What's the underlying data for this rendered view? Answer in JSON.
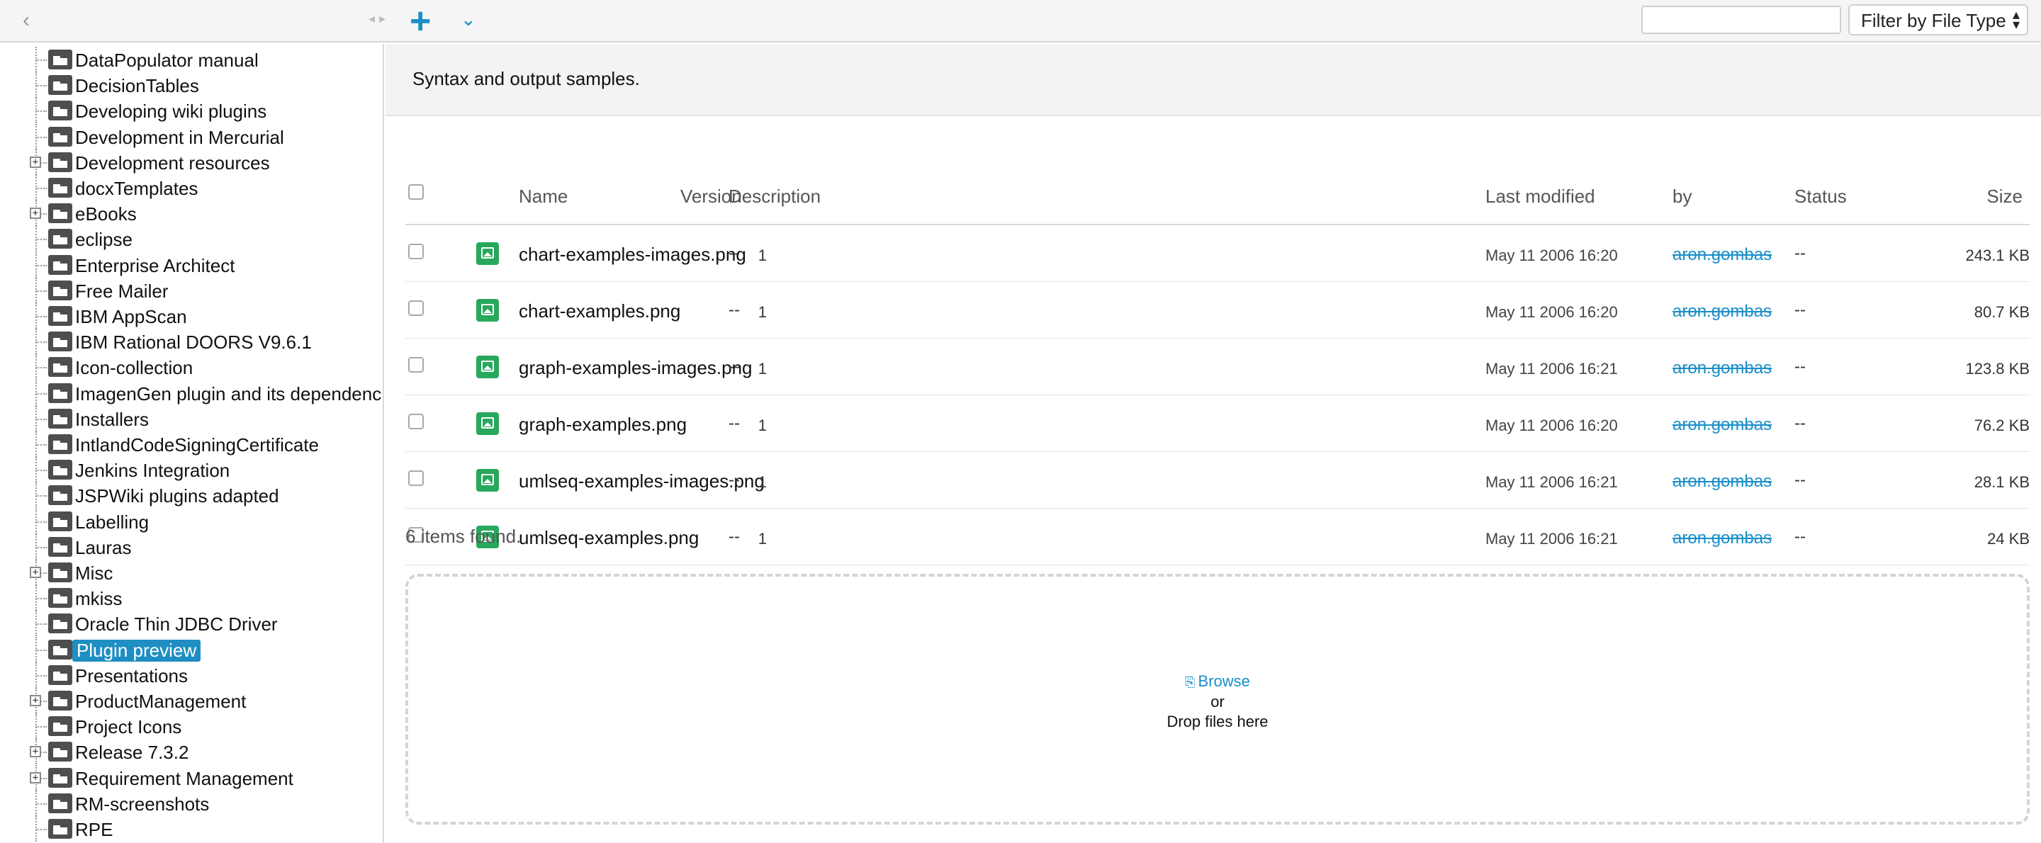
{
  "toolbar": {
    "collapse_icon": "chevron-left-icon",
    "tree_scroll_icons": "arrow-left-right-icons",
    "add_icon": "plus-icon",
    "more_icon": "chevron-down-icon",
    "filter_input_value": "",
    "filter_select_value": "Filter by File Type",
    "accent_color": "#1a8fc8"
  },
  "tree": {
    "items": [
      {
        "label": "DataPopulator manual",
        "expandable": false
      },
      {
        "label": "DecisionTables",
        "expandable": false
      },
      {
        "label": "Developing wiki plugins",
        "expandable": false
      },
      {
        "label": "Development in Mercurial",
        "expandable": false
      },
      {
        "label": "Development resources",
        "expandable": true
      },
      {
        "label": "docxTemplates",
        "expandable": false
      },
      {
        "label": "eBooks",
        "expandable": true
      },
      {
        "label": "eclipse",
        "expandable": false
      },
      {
        "label": "Enterprise Architect",
        "expandable": false
      },
      {
        "label": "Free Mailer",
        "expandable": false
      },
      {
        "label": "IBM AppScan",
        "expandable": false
      },
      {
        "label": "IBM Rational DOORS V9.6.1",
        "expandable": false
      },
      {
        "label": "Icon-collection",
        "expandable": false
      },
      {
        "label": "ImagenGen plugin and its dependenc",
        "expandable": false
      },
      {
        "label": "Installers",
        "expandable": false
      },
      {
        "label": "IntlandCodeSigningCertificate",
        "expandable": false
      },
      {
        "label": "Jenkins Integration",
        "expandable": false
      },
      {
        "label": "JSPWiki plugins adapted",
        "expandable": false
      },
      {
        "label": "Labelling",
        "expandable": false
      },
      {
        "label": "Lauras",
        "expandable": false
      },
      {
        "label": "Misc",
        "expandable": true
      },
      {
        "label": "mkiss",
        "expandable": false
      },
      {
        "label": "Oracle Thin JDBC Driver",
        "expandable": false
      },
      {
        "label": "Plugin preview",
        "expandable": false,
        "selected": true
      },
      {
        "label": "Presentations",
        "expandable": false
      },
      {
        "label": "ProductManagement",
        "expandable": true
      },
      {
        "label": "Project Icons",
        "expandable": false
      },
      {
        "label": "Release 7.3.2",
        "expandable": true
      },
      {
        "label": "Requirement Management",
        "expandable": true
      },
      {
        "label": "RM-screenshots",
        "expandable": false
      },
      {
        "label": "RPE",
        "expandable": false
      }
    ],
    "selected_color": "#1f8ec2"
  },
  "main": {
    "description": "Syntax and output samples.",
    "columns": {
      "name": "Name",
      "version": "Version",
      "description": "Description",
      "last_modified": "Last modified",
      "by": "by",
      "status": "Status",
      "size": "Size"
    },
    "files": [
      {
        "name": "chart-examples-images.png",
        "version": "1",
        "description": "--",
        "modified": "May 11 2006 16:20",
        "by": "aron.gombas",
        "status": "--",
        "size": "243.1 KB"
      },
      {
        "name": "chart-examples.png",
        "version": "1",
        "description": "--",
        "modified": "May 11 2006 16:20",
        "by": "aron.gombas",
        "status": "--",
        "size": "80.7 KB"
      },
      {
        "name": "graph-examples-images.png",
        "version": "1",
        "description": "--",
        "modified": "May 11 2006 16:21",
        "by": "aron.gombas",
        "status": "--",
        "size": "123.8 KB"
      },
      {
        "name": "graph-examples.png",
        "version": "1",
        "description": "--",
        "modified": "May 11 2006 16:20",
        "by": "aron.gombas",
        "status": "--",
        "size": "76.2 KB"
      },
      {
        "name": "umlseq-examples-images.png",
        "version": "1",
        "description": "--",
        "modified": "May 11 2006 16:21",
        "by": "aron.gombas",
        "status": "--",
        "size": "28.1 KB"
      },
      {
        "name": "umlseq-examples.png",
        "version": "1",
        "description": "--",
        "modified": "May 11 2006 16:21",
        "by": "aron.gombas",
        "status": "--",
        "size": "24 KB"
      }
    ],
    "file_icon": "image-file-icon",
    "file_icon_color": "#27a85c",
    "items_found": "6 items found.",
    "dropzone": {
      "browse_label": "Browse",
      "or_label": "or",
      "drop_label": "Drop files here",
      "clip_icon": "paperclip-icon"
    }
  }
}
